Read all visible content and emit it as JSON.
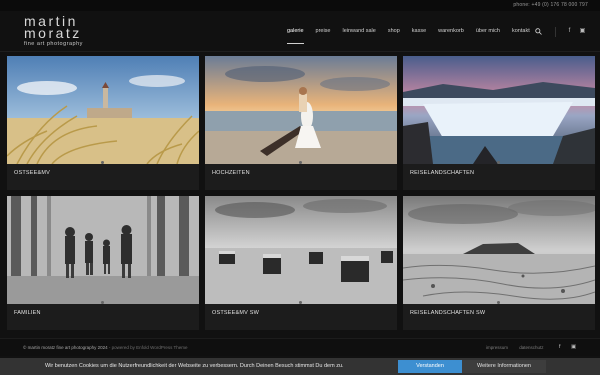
{
  "topbar": {
    "phone": "phone: +49 (0) 176 78 000 797"
  },
  "header": {
    "logo_line1": "martin",
    "logo_line2": "moratz",
    "logo_sub": "fine art photography"
  },
  "nav": {
    "items": [
      {
        "label": "galerie",
        "active": true
      },
      {
        "label": "preise",
        "active": false
      },
      {
        "label": "leinwand sale",
        "active": false
      },
      {
        "label": "shop",
        "active": false
      },
      {
        "label": "kasse",
        "active": false
      },
      {
        "label": "warenkorb",
        "active": false
      },
      {
        "label": "über mich",
        "active": false
      },
      {
        "label": "kontakt",
        "active": false
      }
    ],
    "social": [
      "f",
      "▣"
    ]
  },
  "gallery": {
    "tiles": [
      {
        "caption": "OSTSEE&MV"
      },
      {
        "caption": "HOCHZEITEN"
      },
      {
        "caption": "REISELANDSCHAFTEN"
      },
      {
        "caption": "FAMILIEN"
      },
      {
        "caption": "OSTSEE&MV SW"
      },
      {
        "caption": "REISELANDSCHAFTEN SW"
      }
    ]
  },
  "footer": {
    "copyright": "© martin moratz fine art photography 2024",
    "powered": " - powered by Enfold WordPress Theme",
    "links": [
      "impressum",
      "datenschutz"
    ],
    "social": [
      "f",
      "▣"
    ]
  },
  "cookie": {
    "text": "Wir benutzen Cookies um die Nutzerfreundlichkeit der Webseite zu verbessern. Durch Deinen Besuch stimmst Du dem zu.",
    "accept": "Verstanden",
    "more": "Weitere Informationen"
  }
}
